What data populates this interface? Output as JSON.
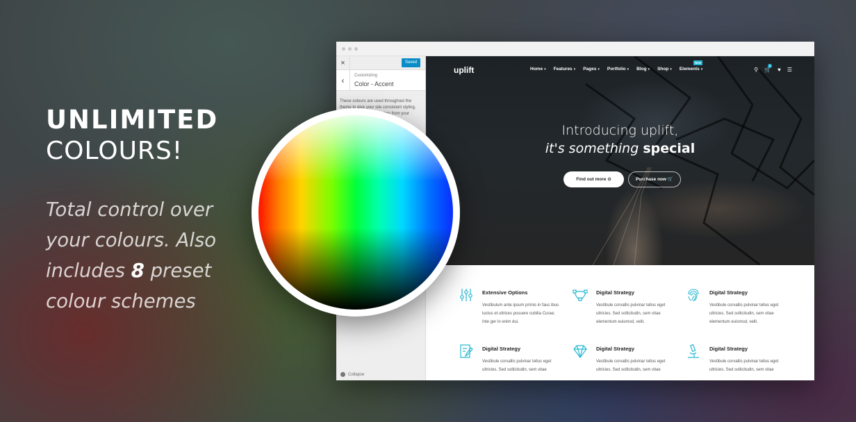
{
  "promo": {
    "title_line1": "UNLIMITED",
    "title_line2": "COLOURS!",
    "desc_before": "Total control over your colours. Also includes ",
    "desc_number": "8",
    "desc_after": " preset colour schemes"
  },
  "customizer": {
    "close_label": "×",
    "saved_label": "Saved",
    "back_label": "‹",
    "customizing_label": "Customizing",
    "section_title": "Color - Accent",
    "description": "These colours are used throughout the theme to give your site consistent styling, these would likely be colors from your identity colour guidelines.",
    "collapse_label": "Collapse"
  },
  "site": {
    "logo": "uplift",
    "nav": [
      {
        "label": "Home",
        "caret": "▾"
      },
      {
        "label": "Features",
        "caret": "▾"
      },
      {
        "label": "Pages",
        "caret": "▾"
      },
      {
        "label": "Portfolio",
        "caret": "▾"
      },
      {
        "label": "Blog",
        "caret": "▾"
      },
      {
        "label": "Shop",
        "caret": "▾"
      },
      {
        "label": "Elements",
        "caret": "▾",
        "badge": "New"
      }
    ],
    "nav_icons": {
      "search": "⚲",
      "cart": "🛒",
      "cart_count": "0",
      "heart": "♥",
      "menu": "☰"
    },
    "hero_title": "Introducing uplift,",
    "hero_sub_italic": "it's something",
    "hero_sub_bold": "special",
    "btn_primary": "Find out more  ⊙",
    "btn_secondary": "Purchase now  🛒",
    "accent_color": "#25b7d3"
  },
  "features": [
    {
      "icon": "sliders-icon",
      "title": "Extensive Options",
      "text": "Vestibulum ante ipsum primis in fauc ibus luctus et ultrices posuere cubilia Curae; Inte ger in enim dui."
    },
    {
      "icon": "vector-nodes-icon",
      "title": "Digital Strategy",
      "text": "Vestibule corvallis pulvinar tellus eget ultricies. Sed sollicitudin, sem vitae elementum euismod, velit."
    },
    {
      "icon": "fingerprint-icon",
      "title": "Digital Strategy",
      "text": "Vestibule corvallis pulvinar tellus eget ultricies. Sed sollicitudin, sem vitae elementum euismod, velit."
    },
    {
      "icon": "document-edit-icon",
      "title": "Digital Strategy",
      "text": "Vestibule corvallis pulvinar tellus eget ultricies. Sed sollicitudin, sem vitae"
    },
    {
      "icon": "diamond-icon",
      "title": "Digital Strategy",
      "text": "Vestibule corvallis pulvinar tellus eget ultricies. Sed sollicitudin, sem vitae"
    },
    {
      "icon": "microscope-icon",
      "title": "Digital Strategy",
      "text": "Vestibule corvallis pulvinar tellus eget ultricies. Sed sollicitudin, sem vitae"
    }
  ]
}
